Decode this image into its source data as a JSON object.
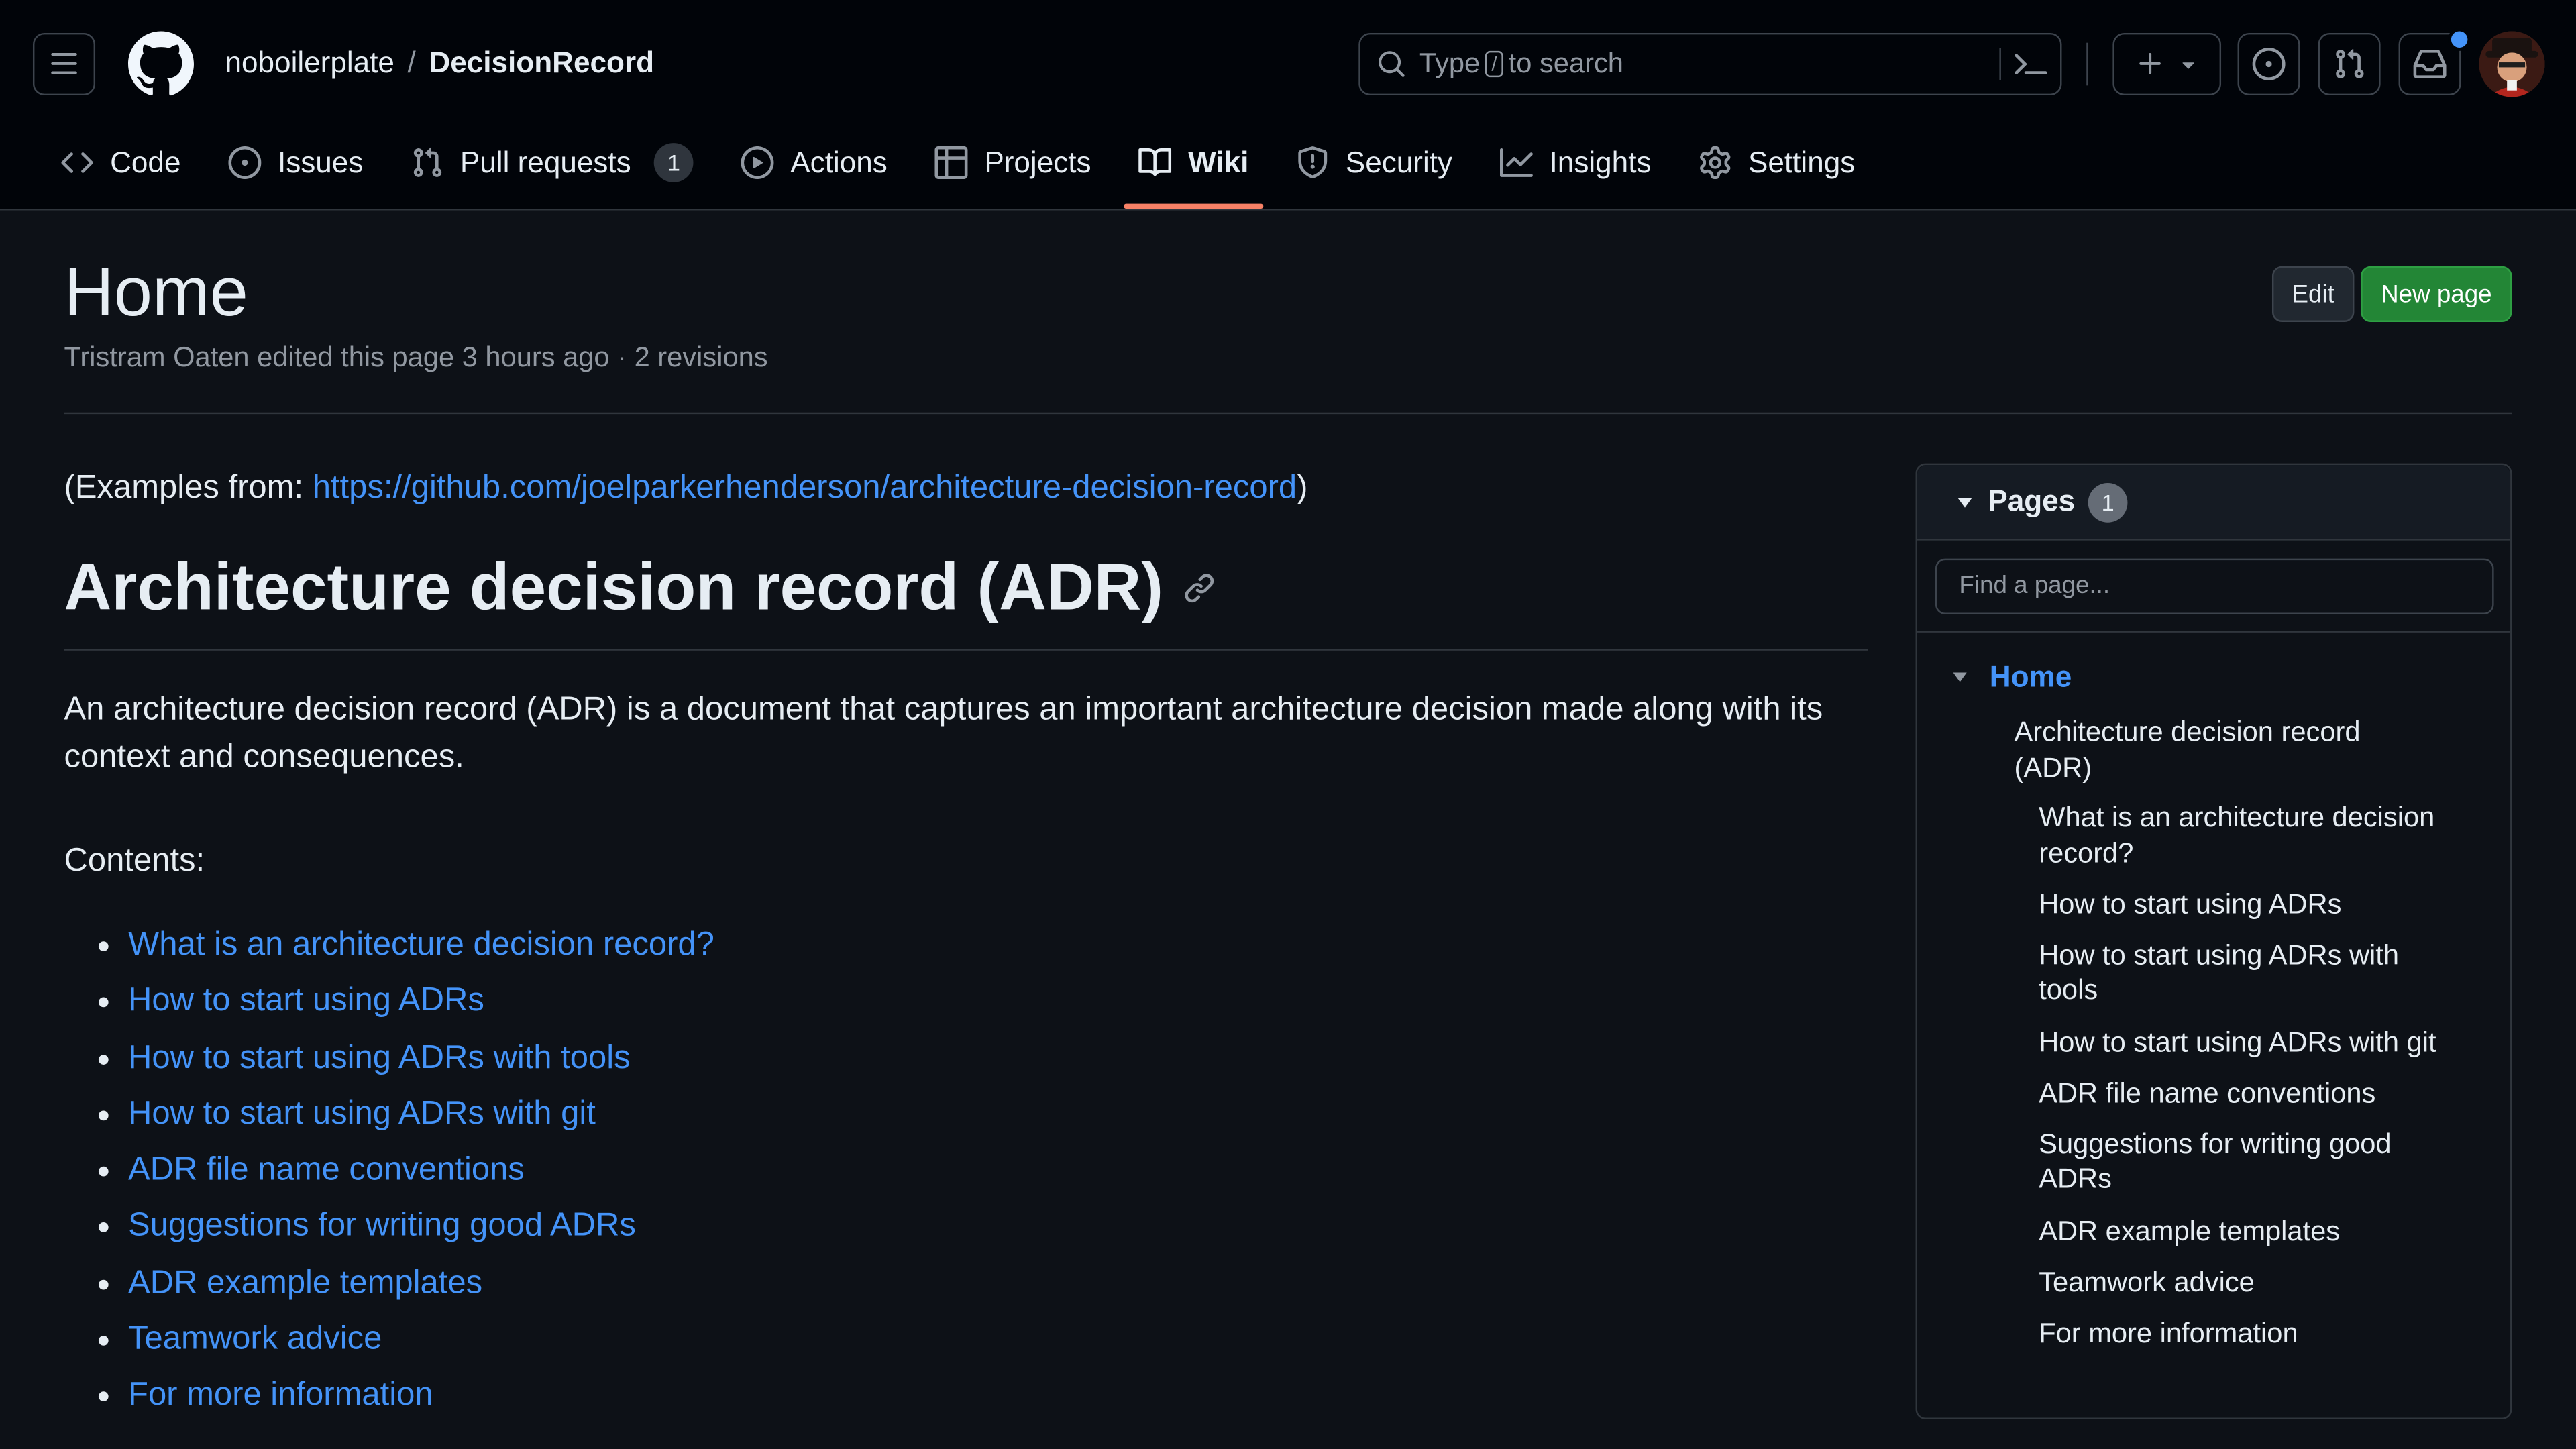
{
  "header": {
    "owner": "noboilerplate",
    "separator": "/",
    "repo": "DecisionRecord",
    "search": {
      "before": "Type",
      "key": "/",
      "after": "to search"
    }
  },
  "nav": {
    "tabs": [
      {
        "label": "Code",
        "icon": "code-icon"
      },
      {
        "label": "Issues",
        "icon": "issue-icon"
      },
      {
        "label": "Pull requests",
        "icon": "pull-request-icon",
        "count": "1"
      },
      {
        "label": "Actions",
        "icon": "play-icon"
      },
      {
        "label": "Projects",
        "icon": "table-icon"
      },
      {
        "label": "Wiki",
        "icon": "book-icon",
        "active": true
      },
      {
        "label": "Security",
        "icon": "shield-icon"
      },
      {
        "label": "Insights",
        "icon": "graph-icon"
      },
      {
        "label": "Settings",
        "icon": "gear-icon"
      }
    ]
  },
  "page": {
    "title": "Home",
    "meta": "Tristram Oaten edited this page 3 hours ago · 2 revisions",
    "edit_label": "Edit",
    "new_page_label": "New page"
  },
  "article": {
    "intro_prefix": "(Examples from: ",
    "intro_link": "https://github.com/joelparkerhenderson/architecture-decision-record",
    "intro_suffix": ")",
    "heading": "Architecture decision record (ADR)",
    "paragraph": "An architecture decision record (ADR) is a document that captures an important architecture decision made along with its context and consequences.",
    "contents_label": "Contents:",
    "toc": [
      "What is an architecture decision record?",
      "How to start using ADRs",
      "How to start using ADRs with tools",
      "How to start using ADRs with git",
      "ADR file name conventions",
      "Suggestions for writing good ADRs",
      "ADR example templates",
      "Teamwork advice",
      "For more information"
    ]
  },
  "sidebar": {
    "title": "Pages",
    "count": "1",
    "search_placeholder": "Find a page...",
    "home": "Home",
    "section": "Architecture decision record (ADR)",
    "items": [
      "What is an architecture decision record?",
      "How to start using ADRs",
      "How to start using ADRs with tools",
      "How to start using ADRs with git",
      "ADR file name conventions",
      "Suggestions for writing good ADRs",
      "ADR example templates",
      "Teamwork advice",
      "For more information"
    ]
  },
  "colors": {
    "background": "#0d1117",
    "header": "#010409",
    "link": "#4493f8",
    "accent_underline": "#f78166",
    "primary_button": "#238636"
  }
}
